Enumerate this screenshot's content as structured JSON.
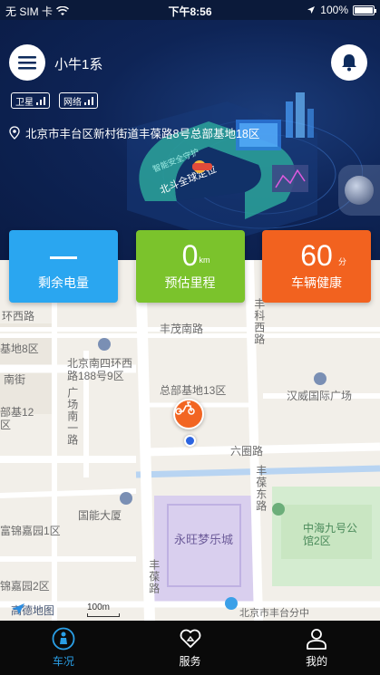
{
  "status_bar": {
    "carrier": "无 SIM 卡",
    "time": "下午8:56",
    "battery": "100%",
    "battery_level": 1.0
  },
  "header": {
    "car_name": "小牛1系",
    "signals": [
      {
        "label": "卫星"
      },
      {
        "label": "网络"
      }
    ],
    "address": "北京市丰台区新村街道丰葆路8号总部基地18区",
    "illustration_text": [
      "北斗全球定位",
      "智能安全守护"
    ]
  },
  "cards": [
    {
      "value": "",
      "unit": "",
      "label": "剩余电量",
      "color": "#2aa6f0"
    },
    {
      "value": "0",
      "unit": "km",
      "label": "预估里程",
      "color": "#7bc32c"
    },
    {
      "value": "60",
      "unit": "分",
      "label": "车辆健康",
      "color": "#f2621f"
    }
  ],
  "map": {
    "labels": {
      "huan_xi_lu": "环西路",
      "feng_mao_nan_lu": "丰茂南路",
      "feng_ke_xi_lu": "丰科西路",
      "ji_di_8": "基地8区",
      "beijing_nan_si_huan": "北京南四环西路188号9区",
      "nan_jie": "南街",
      "guang_chang_nan_yi_lu": "广场南一路",
      "zong_bu_ji_di_13": "总部基地13区",
      "han_wei": "汉威国际广场",
      "bu_ji_12": "部基12区",
      "liu_quan_lu": "六圈路",
      "feng_bao_dong_lu": "丰葆东路",
      "guo_neng_da_sha": "国能大厦",
      "jin_jia_yuan_1": "富锦嘉园1区",
      "zhong_hai_jiu_hao": "中海九号公馆2区",
      "yong_wang_meng": "永旺梦乐城",
      "feng_bao_lu": "丰葆路",
      "jin_jia_yuan_2": "锦嘉园2区",
      "bei_jing_shi": "北京市丰台分中",
      "amap": "高德地图",
      "scale": "100m"
    }
  },
  "tabs": [
    {
      "label": "车况",
      "active": true
    },
    {
      "label": "服务",
      "active": false
    },
    {
      "label": "我的",
      "active": false
    }
  ]
}
